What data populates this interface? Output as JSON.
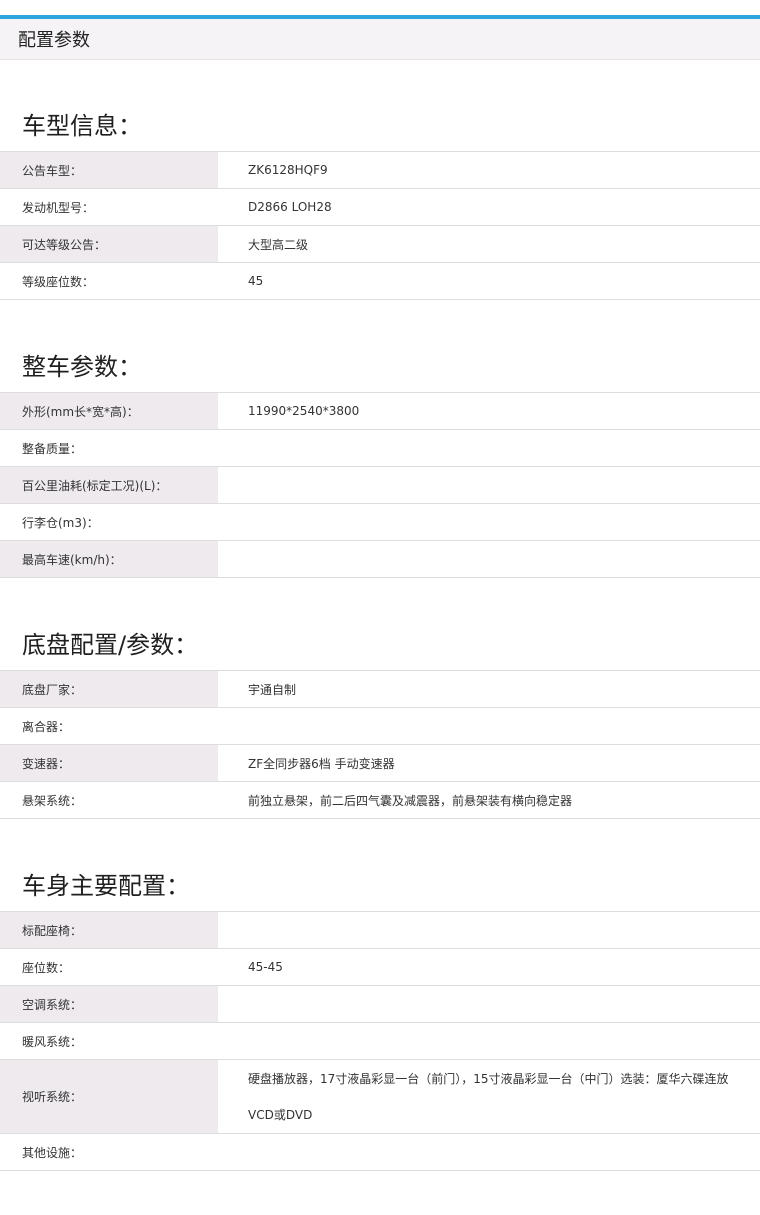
{
  "header": {
    "title": "配置参数"
  },
  "sections": [
    {
      "title": "车型信息：",
      "rows": [
        {
          "label": "公告车型：",
          "value": "ZK6128HQF9"
        },
        {
          "label": "发动机型号：",
          "value": "D2866 LOH28"
        },
        {
          "label": "可达等级公告：",
          "value": "大型高二级"
        },
        {
          "label": "等级座位数：",
          "value": "45"
        }
      ]
    },
    {
      "title": "整车参数：",
      "rows": [
        {
          "label": "外形(mm长*宽*高)：",
          "value": "11990*2540*3800"
        },
        {
          "label": "整备质量：",
          "value": ""
        },
        {
          "label": "百公里油耗(标定工况)(L)：",
          "value": ""
        },
        {
          "label": "行李仓(m3)：",
          "value": ""
        },
        {
          "label": "最高车速(km/h)：",
          "value": ""
        }
      ]
    },
    {
      "title": "底盘配置/参数：",
      "rows": [
        {
          "label": "底盘厂家：",
          "value": "宇通自制"
        },
        {
          "label": "离合器：",
          "value": ""
        },
        {
          "label": "变速器：",
          "value": "ZF全同步器6档 手动变速器"
        },
        {
          "label": "悬架系统：",
          "value": "前独立悬架，前二后四气囊及减震器，前悬架装有横向稳定器"
        }
      ]
    },
    {
      "title": "车身主要配置：",
      "rows": [
        {
          "label": "标配座椅：",
          "value": ""
        },
        {
          "label": "座位数：",
          "value": "45-45"
        },
        {
          "label": "空调系统：",
          "value": ""
        },
        {
          "label": "暖风系统：",
          "value": ""
        },
        {
          "label": "视听系统：",
          "value": "硬盘播放器，17寸液晶彩显一台（前门），15寸液晶彩显一台（中门）选装：厦华六碟连放VCD或DVD"
        },
        {
          "label": "其他设施：",
          "value": ""
        }
      ]
    }
  ]
}
